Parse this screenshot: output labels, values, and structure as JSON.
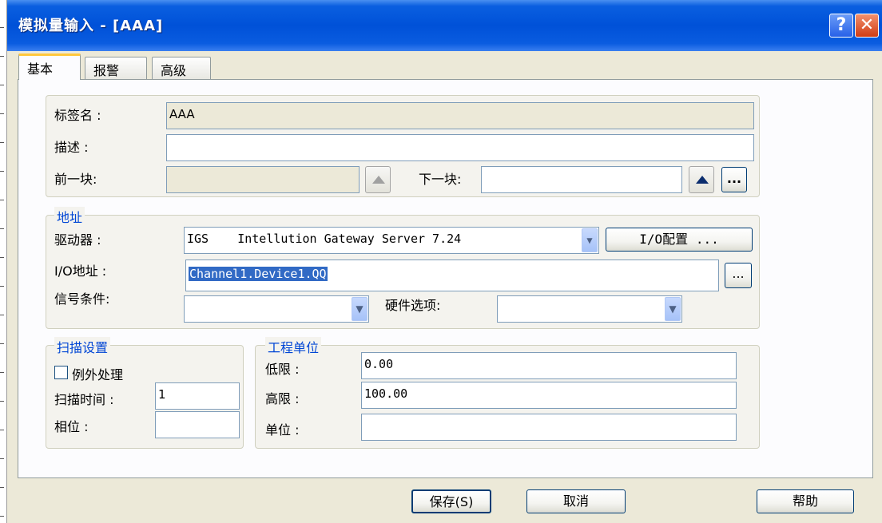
{
  "window": {
    "title": "模拟量输入 - [AAA]",
    "help_glyph": "?",
    "close_glyph": "✕"
  },
  "tabs": [
    {
      "label": "基本",
      "active": true
    },
    {
      "label": "报警",
      "active": false
    },
    {
      "label": "高级",
      "active": false
    }
  ],
  "basic": {
    "tag_name_label": "标签名 :",
    "tag_name_value": "AAA",
    "description_label": "描述 :",
    "description_value": "",
    "prev_block_label": "前一块:",
    "prev_block_value": "",
    "next_block_label": "下一块:",
    "next_block_value": "",
    "browse_label": "..."
  },
  "address": {
    "legend": "地址",
    "driver_label": "驱动器 :",
    "driver_value": "IGS    Intellution Gateway Server 7.24",
    "io_config_button": "I/O配置 ...",
    "io_address_label": "I/O地址 :",
    "io_address_value": "Channel1.Device1.QQ",
    "io_browse_label": "...",
    "signal_condition_label": "信号条件:",
    "signal_condition_value": "",
    "hardware_options_label": "硬件选项:",
    "hardware_options_value": ""
  },
  "scan": {
    "legend": "扫描设置",
    "exception_label": "例外处理",
    "exception_checked": false,
    "scan_time_label": "扫描时间 :",
    "scan_time_value": "1",
    "phase_label": "相位 :",
    "phase_value": ""
  },
  "eng_units": {
    "legend": "工程单位",
    "low_label": "低限 :",
    "low_value": "0.00",
    "high_label": "高限 :",
    "high_value": "100.00",
    "unit_label": "单位 :",
    "unit_value": ""
  },
  "footer": {
    "save_button": "保存(S)",
    "cancel_button": "取消",
    "help_button": "帮助"
  },
  "icons": {
    "dropdown": "chevron-down-icon",
    "up_arrow": "triangle-up-icon"
  },
  "colors": {
    "title_bar": "#0051d8",
    "legend_text": "#0046d5",
    "dialog_bg": "#ece9d8",
    "selection": "#316ac5"
  }
}
